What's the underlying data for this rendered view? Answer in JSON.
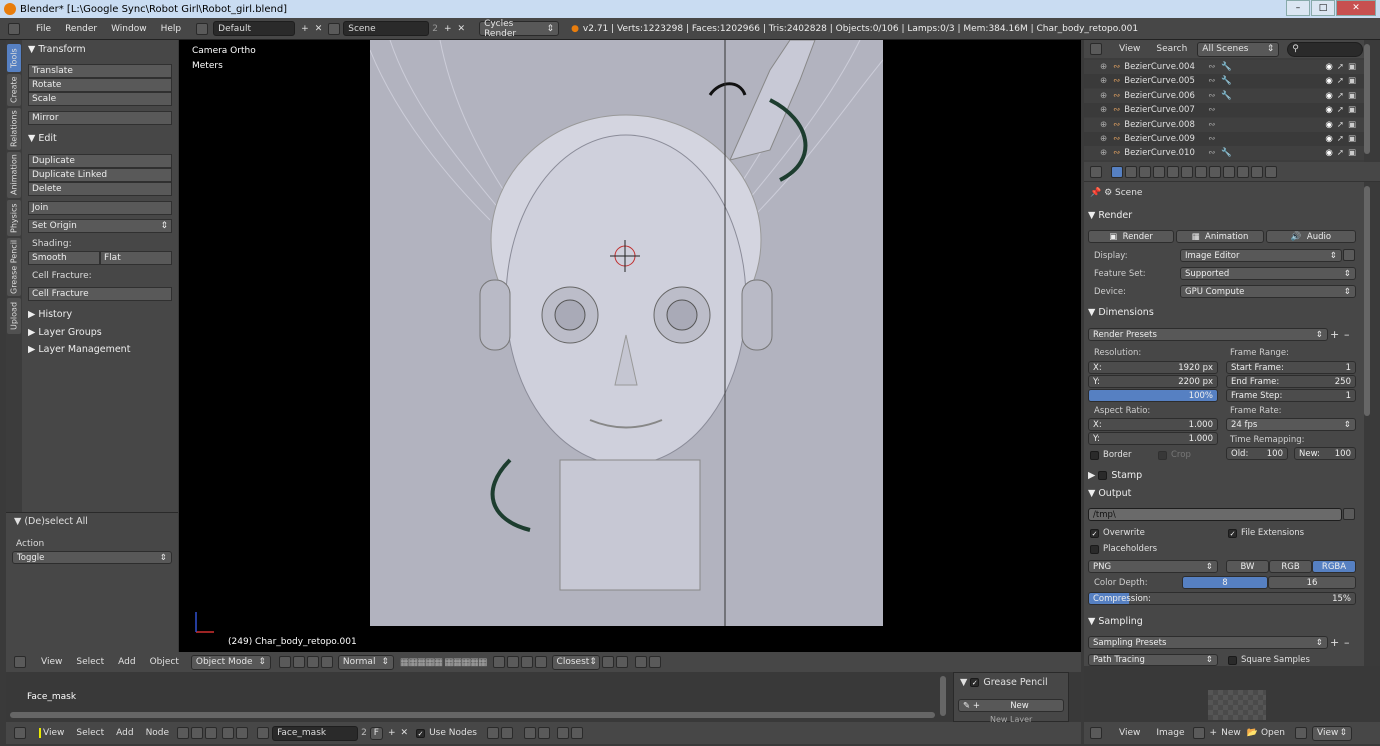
{
  "window": {
    "title": "Blender* [L:\\Google Sync\\Robot Girl\\Robot_girl.blend]"
  },
  "infobar": {
    "menus": [
      "File",
      "Render",
      "Window",
      "Help"
    ],
    "layout": "Default",
    "scene": "Scene",
    "scene_num": "2",
    "engine": "Cycles Render",
    "stats": "v2.71 | Verts:1223298 | Faces:1202966 | Tris:2402828 | Objects:0/106 | Lamps:0/3 | Mem:384.16M | Char_body_retopo.001"
  },
  "toolshelf": {
    "tabs": [
      "Tools",
      "Create",
      "Relations",
      "Animation",
      "Physics",
      "Grease Pencil",
      "Upload"
    ],
    "transform": {
      "header": "Transform",
      "buttons": [
        "Translate",
        "Rotate",
        "Scale",
        "Mirror"
      ]
    },
    "edit": {
      "header": "Edit",
      "buttons": [
        "Duplicate",
        "Duplicate Linked",
        "Delete",
        "Join"
      ],
      "set_origin": "Set Origin",
      "shading_label": "Shading:",
      "smooth": "Smooth",
      "flat": "Flat",
      "cell_fracture_label": "Cell Fracture:",
      "cell_fracture": "Cell Fracture"
    },
    "collapsed": [
      "History",
      "Layer Groups",
      "Layer Management"
    ],
    "operator": {
      "header": "(De)select All",
      "action_label": "Action",
      "action_value": "Toggle"
    }
  },
  "viewport": {
    "view_name": "Camera Ortho",
    "units": "Meters",
    "object_info": "(249) Char_body_retopo.001"
  },
  "viewport_header": {
    "menus": [
      "View",
      "Select",
      "Add",
      "Object"
    ],
    "mode": "Object Mode",
    "orientation": "Normal",
    "snap": "Closest"
  },
  "node_editor": {
    "material_label": "Face_mask",
    "grease_pencil": "Grease Pencil",
    "new_btn": "New",
    "new_layer": "New Layer",
    "menus": [
      "View",
      "Select",
      "Add",
      "Node"
    ],
    "material": "Face_mask",
    "mat_users": "2",
    "fake_user": "F",
    "use_nodes": "Use Nodes"
  },
  "outliner": {
    "view": "View",
    "search": "Search",
    "filter": "All Scenes",
    "items": [
      "BezierCurve.004",
      "BezierCurve.005",
      "BezierCurve.006",
      "BezierCurve.007",
      "BezierCurve.008",
      "BezierCurve.009",
      "BezierCurve.010"
    ]
  },
  "properties": {
    "context": "Scene",
    "render": {
      "header": "Render",
      "btn_render": "Render",
      "btn_animation": "Animation",
      "btn_audio": "Audio",
      "display_label": "Display:",
      "display": "Image Editor",
      "feature_label": "Feature Set:",
      "feature": "Supported",
      "device_label": "Device:",
      "device": "GPU Compute"
    },
    "dimensions": {
      "header": "Dimensions",
      "presets": "Render Presets",
      "resolution_label": "Resolution:",
      "res_x_label": "X:",
      "res_x": "1920 px",
      "res_y_label": "Y:",
      "res_y": "2200 px",
      "res_pct": "100%",
      "frame_range_label": "Frame Range:",
      "start_label": "Start Frame:",
      "start": "1",
      "end_label": "End Frame:",
      "end": "250",
      "step_label": "Frame Step:",
      "step": "1",
      "aspect_label": "Aspect Ratio:",
      "asp_x_label": "X:",
      "asp_x": "1.000",
      "asp_y_label": "Y:",
      "asp_y": "1.000",
      "frame_rate_label": "Frame Rate:",
      "frame_rate": "24 fps",
      "border": "Border",
      "crop": "Crop",
      "remap_label": "Time Remapping:",
      "old_label": "Old:",
      "old": "100",
      "new_label": "New:",
      "new": "100"
    },
    "stamp": {
      "header": "Stamp"
    },
    "output": {
      "header": "Output",
      "path": "/tmp\\",
      "overwrite": "Overwrite",
      "file_ext": "File Extensions",
      "placeholders": "Placeholders",
      "format": "PNG",
      "bw": "BW",
      "rgb": "RGB",
      "rgba": "RGBA",
      "depth_label": "Color Depth:",
      "depth8": "8",
      "depth16": "16",
      "compression_label": "Compression:",
      "compression": "15%"
    },
    "sampling": {
      "header": "Sampling",
      "presets": "Sampling Presets",
      "integrator": "Path Tracing",
      "square": "Square Samples"
    }
  },
  "image_editor": {
    "menus": [
      "View",
      "Image"
    ],
    "new": "New",
    "open": "Open",
    "view": "View"
  },
  "colors": {
    "accent": "#5680c2",
    "panel": "#474747",
    "bg": "#3a3a3a"
  }
}
